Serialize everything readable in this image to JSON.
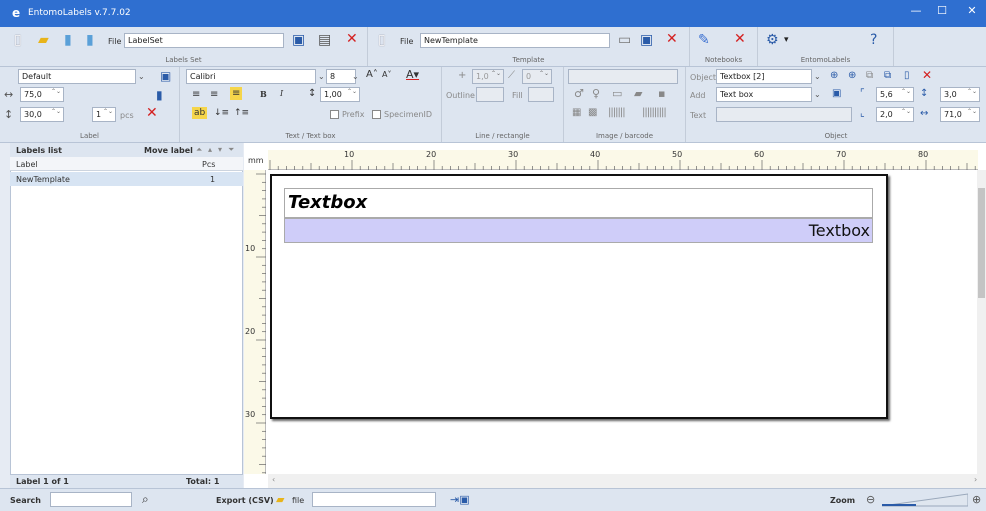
{
  "window": {
    "title": "EntomoLabels v.7.7.02",
    "app_icon": "e"
  },
  "labels_set": {
    "file_label": "File",
    "file_value": "LabelSet",
    "caption": "Labels Set"
  },
  "template": {
    "file_label": "File",
    "file_value": "NewTemplate",
    "caption": "Template"
  },
  "notebooks": {
    "caption": "Notebooks"
  },
  "entomolabels": {
    "caption": "EntomoLabels"
  },
  "label": {
    "preset": "Default",
    "width": "75,0",
    "height": "30,0",
    "pcs_value": "1",
    "pcs_label": "pcs",
    "caption": "Label"
  },
  "text": {
    "font": "Calibri",
    "size": "8",
    "line_spacing": "1,00",
    "prefix_label": "Prefix",
    "specimenid_label": "SpecimenID",
    "caption": "Text / Text box"
  },
  "line": {
    "width": "1,0",
    "angle": "0",
    "outline_label": "Outline",
    "fill_label": "Fill",
    "caption": "Line / rectangle"
  },
  "image": {
    "caption": "Image / barcode"
  },
  "object": {
    "object_label": "Object",
    "object_value": "Textbox [2]",
    "add_label": "Add",
    "add_value": "Text box",
    "text_label": "Text",
    "v1": "5,6",
    "v2": "3,0",
    "v3": "2,0",
    "v4": "71,0",
    "caption": "Object"
  },
  "labels_list": {
    "header": "Labels list",
    "move_label": "Move label",
    "col_label": "Label",
    "col_pcs": "Pcs",
    "rows": [
      {
        "label": "NewTemplate",
        "pcs": "1"
      }
    ],
    "footer_left": "Label  1  of  1",
    "footer_right": "Total: 1"
  },
  "ruler": {
    "unit": "mm",
    "h_ticks": [
      "10",
      "20",
      "30",
      "40",
      "50",
      "60",
      "70",
      "80"
    ],
    "v_ticks": [
      "10",
      "20",
      "30"
    ]
  },
  "canvas": {
    "textbox1": "Textbox",
    "textbox2": "Textbox"
  },
  "status": {
    "search_label": "Search",
    "export_label": "Export (CSV)",
    "file_label": "file",
    "zoom_label": "Zoom"
  }
}
